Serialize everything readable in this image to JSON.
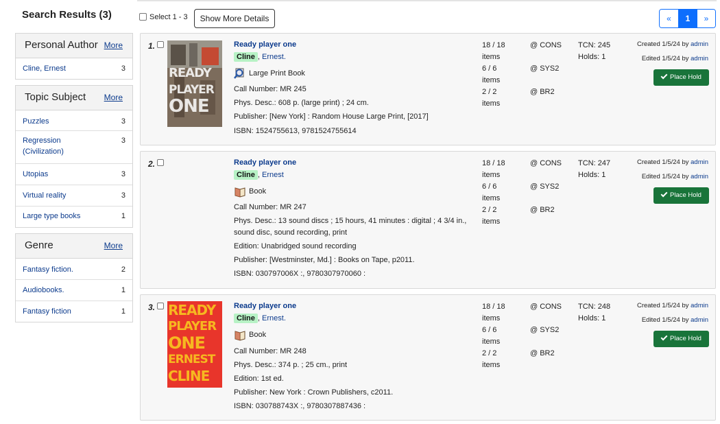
{
  "header": {
    "results_title": "Search Results (3)"
  },
  "controls": {
    "select_label": "Select 1 - 3",
    "more_details": "Show More Details",
    "pager": {
      "prev": "«",
      "current": "1",
      "next": "»"
    }
  },
  "facets": [
    {
      "title": "Personal Author",
      "more": "More",
      "items": [
        {
          "label": "Cline, Ernest",
          "count": "3"
        }
      ]
    },
    {
      "title": "Topic Subject",
      "more": "More",
      "items": [
        {
          "label": "Puzzles",
          "count": "3"
        },
        {
          "label": "Regression (Civilization)",
          "count": "3"
        },
        {
          "label": "Utopias",
          "count": "3"
        },
        {
          "label": "Virtual reality",
          "count": "3"
        },
        {
          "label": "Large type books",
          "count": "1"
        }
      ]
    },
    {
      "title": "Genre",
      "more": "More",
      "items": [
        {
          "label": "Fantasy fiction.",
          "count": "2"
        },
        {
          "label": "Audiobooks.",
          "count": "1"
        },
        {
          "label": "Fantasy fiction",
          "count": "1"
        }
      ]
    }
  ],
  "records": [
    {
      "num": "1.",
      "title": "Ready player one",
      "author_hl": "Cline",
      "author_rest": "Ernest.",
      "format": "Large Print Book",
      "call_number": "Call Number: MR 245",
      "phys": "Phys. Desc.: 608 p. (large print) ; 24 cm.",
      "publisher": "Publisher: [New York] : Random House Large Print, [2017]",
      "isbn": "ISBN: 1524755613, 9781524755614",
      "holdings": [
        "18 / 18",
        "items",
        "6 / 6",
        "items",
        "2 / 2",
        "items"
      ],
      "libs": [
        "@ CONS",
        "@ SYS2",
        "@ BR2"
      ],
      "tcn": "TCN: 245",
      "holds": "Holds: 1",
      "created": "Created 1/5/24 by",
      "edited": "Edited 1/5/24 by",
      "user": "admin",
      "hold_label": "Place Hold",
      "cover_words": [
        "READY",
        "PLAYER",
        "ONE"
      ]
    },
    {
      "num": "2.",
      "title": "Ready player one",
      "author_hl": "Cline",
      "author_rest": "Ernest",
      "format": "Book",
      "call_number": "Call Number: MR 247",
      "phys": "Phys. Desc.: 13 sound discs ; 15 hours, 41 minutes : digital ; 4 3/4 in., sound disc, sound recording, print",
      "edition": "Edition: Unabridged sound recording",
      "publisher": "Publisher: [Westminster, Md.] : Books on Tape, p2011.",
      "isbn": "ISBN: 030797006X :, 9780307970060 :",
      "holdings": [
        "18 / 18",
        "items",
        "6 / 6",
        "items",
        "2 / 2",
        "items"
      ],
      "libs": [
        "@ CONS",
        "@ SYS2",
        "@ BR2"
      ],
      "tcn": "TCN: 247",
      "holds": "Holds: 1",
      "created": "Created 1/5/24 by",
      "edited": "Edited 1/5/24 by",
      "user": "admin",
      "hold_label": "Place Hold"
    },
    {
      "num": "3.",
      "title": "Ready player one",
      "author_hl": "Cline",
      "author_rest": "Ernest.",
      "format": "Book",
      "call_number": "Call Number: MR 248",
      "phys": "Phys. Desc.: 374 p. ; 25 cm., print",
      "edition": "Edition: 1st ed.",
      "publisher": "Publisher: New York : Crown Publishers, c2011.",
      "isbn": "ISBN: 030788743X :, 9780307887436 :",
      "holdings": [
        "18 / 18",
        "items",
        "6 / 6",
        "items",
        "2 / 2",
        "items"
      ],
      "libs": [
        "@ CONS",
        "@ SYS2",
        "@ BR2"
      ],
      "tcn": "TCN: 248",
      "holds": "Holds: 1",
      "created": "Created 1/5/24 by",
      "edited": "Edited 1/5/24 by",
      "user": "admin",
      "hold_label": "Place Hold",
      "cover_words": [
        "READY",
        "PLAYER",
        "ONE",
        "ERNEST",
        "CLINE"
      ]
    }
  ],
  "colors": {
    "link": "#0b3a8c",
    "hold_button": "#19743a",
    "highlight": "#b7f2c5",
    "pager_blue": "#0d6efd"
  }
}
